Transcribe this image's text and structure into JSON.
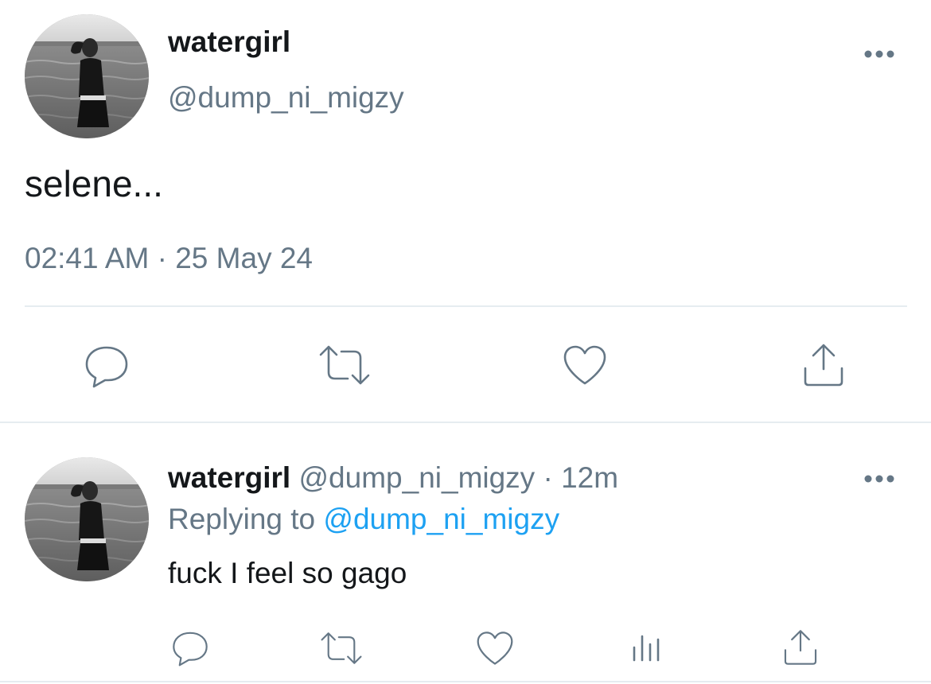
{
  "main_tweet": {
    "display_name": "watergirl",
    "handle": "@dump_ni_migzy",
    "text": "selene...",
    "time": "02:41 AM",
    "separator": "·",
    "date": "25 May 24",
    "more_icon": "more-horizontal-icon",
    "actions": [
      "reply-icon",
      "retweet-icon",
      "like-icon",
      "share-icon"
    ]
  },
  "reply_tweet": {
    "display_name": "watergirl",
    "handle": "@dump_ni_migzy",
    "separator": "·",
    "age": "12m",
    "replying_prefix": "Replying to",
    "replying_handle": "@dump_ni_migzy",
    "text": "fuck I feel so gago",
    "more_icon": "more-horizontal-icon",
    "actions": [
      "reply-icon",
      "retweet-icon",
      "like-icon",
      "analytics-icon",
      "share-icon"
    ]
  },
  "colors": {
    "text": "#14171a",
    "muted": "#657786",
    "link": "#1da1f2",
    "divider": "#e6ecf0"
  }
}
